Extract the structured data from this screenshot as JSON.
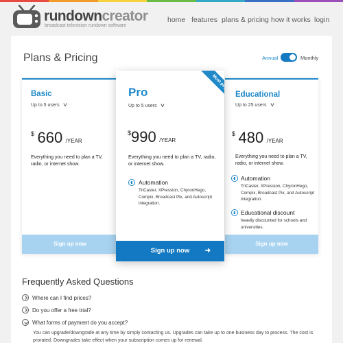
{
  "theme": {
    "accent": "#1e88c9",
    "accent_dark": "#1379c2",
    "signup_light": "#a8d3f0",
    "rainbow": [
      "#e94a3f",
      "#f49a2a",
      "#f6d23c",
      "#68bb45",
      "#33a9c7",
      "#3b6fc4",
      "#9b4fb7"
    ]
  },
  "header": {
    "brand_part1": "rundown",
    "brand_part2": "creator",
    "tagline": "broadcast television rundown software",
    "logo_icon": "tv-icon",
    "nav": [
      "home",
      "features",
      "plans & pricing",
      "how it works",
      "login"
    ]
  },
  "pricing": {
    "title": "Plans & Pricing",
    "toggle": {
      "left_label": "Annual",
      "right_label": "Monthly",
      "state": "monthly"
    },
    "plans": [
      {
        "name": "Basic",
        "users": "Up to 5 users",
        "currency": "$",
        "price": "660",
        "period": "/YEAR",
        "description": "Everything you need to plan a TV, radio, or internet show.",
        "features": [],
        "signup_label": "Sign up now"
      },
      {
        "name": "Pro",
        "users": "Up to 5 users",
        "currency": "$",
        "price": "990",
        "period": "/YEAR",
        "badge": "Most popular",
        "description": "Everything you need to plan a TV, radio, or internet show.",
        "features": [
          {
            "title": "Automation",
            "text": "TriCaster, XPression, ChyronHego, Compix, Broadcast Pix, and Autoscript integration."
          }
        ],
        "signup_label": "Sign up now",
        "signup_arrow": "arrow-right-icon"
      },
      {
        "name": "Educational",
        "users": "Up to 25 users",
        "currency": "$",
        "price": "480",
        "period": "/YEAR",
        "description": "Everything you need to plan a TV, radio, or internet show.",
        "features": [
          {
            "title": "Automation",
            "text": "TriCaster, XPression, ChyronHego, Compix, Broadcast Pix, and Autoscript integration."
          },
          {
            "title": "Educational discount",
            "text": "heavily discounted for schools and universities."
          }
        ],
        "signup_label": "Sign up now"
      }
    ]
  },
  "faq": {
    "title": "Frequently Asked Questions",
    "items": [
      {
        "question": "Where can I find prices?",
        "open": false
      },
      {
        "question": "Do you offer a free trial?",
        "open": false
      },
      {
        "question": "What forms of payment do you accept?",
        "open": true,
        "answer": "You can upgrade/downgrade at any time by simply contacting us. Upgrades can take up to one business day to process. The cost is prorated. Downgrades take effect when your subscription comes up for renewal."
      }
    ]
  }
}
